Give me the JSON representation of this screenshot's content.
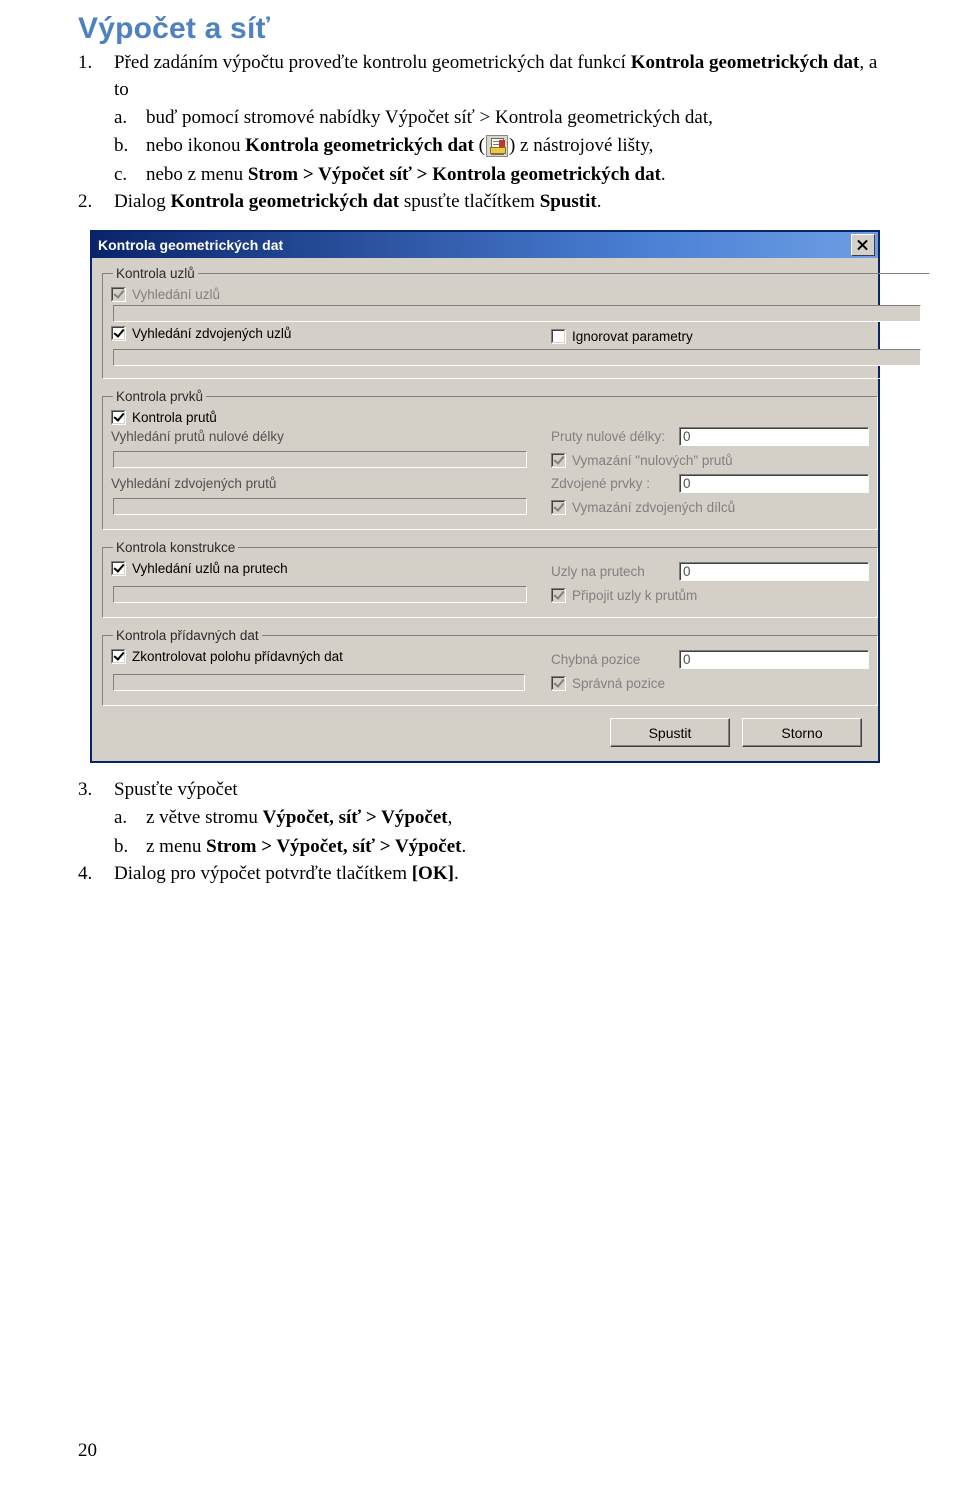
{
  "doc": {
    "title": "Výpočet a síť",
    "page_number": "20"
  },
  "steps": [
    {
      "num": "1.",
      "text_before": "Před zadáním výpočtu proveďte kontrolu geometrických dat funkcí ",
      "bold": "Kontrola geometrických dat",
      "text_after": ", a to",
      "subs": [
        {
          "letter": "a.",
          "pre": "buď pomocí stromové nabídky Výpočet síť > Kontrola geometrických dat,",
          "bold": "",
          "post": ""
        },
        {
          "letter": "b.",
          "pre": "nebo ikonou ",
          "bold": "Kontrola geometrických dat",
          "post": " (",
          "icon": "check-geometry-toolbar-icon",
          "post2": ") z nástrojové lišty,"
        },
        {
          "letter": "c.",
          "pre": "nebo z menu ",
          "bold": "Strom > Výpočet síť > Kontrola geometrických dat",
          "post": "."
        }
      ]
    },
    {
      "num": "2.",
      "text_before": "Dialog ",
      "bold": "Kontrola geometrických dat",
      "text_mid": " spusťte tlačítkem ",
      "bold2": "Spustit",
      "text_after": "."
    },
    {
      "num": "3.",
      "text_before": "Spusťte výpočet",
      "subs": [
        {
          "letter": "a.",
          "pre": "z  větve stromu  ",
          "bold": "Výpočet, síť  > Výpočet",
          "post": ","
        },
        {
          "letter": "b.",
          "pre": "z menu ",
          "bold": "Strom > Výpočet, síť > Výpočet",
          "post": "."
        }
      ]
    },
    {
      "num": "4.",
      "text_before": "Dialog pro výpočet potvrďte tlačítkem ",
      "bold": "[OK]",
      "text_after": "."
    }
  ],
  "dialog": {
    "title": "Kontrola geometrických dat",
    "close_button": "✕",
    "groups": [
      {
        "legend": "Kontrola uzlů",
        "rows": [
          {
            "checkbox": {
              "label": "Vyhledání uzlů",
              "checked": true,
              "disabled": true
            }
          },
          {
            "progress": true
          },
          {
            "checkbox": {
              "label": "Vyhledání zdvojených uzlů",
              "checked": true,
              "disabled": false
            },
            "checkbox_right": {
              "label": "Ignorovat parametry",
              "checked": false,
              "disabled": false
            }
          },
          {
            "progress": true
          }
        ]
      },
      {
        "legend": "Kontrola prvků",
        "rows": [
          {
            "checkbox": {
              "label": "Kontrola prutů",
              "checked": true,
              "disabled": false
            }
          },
          {
            "label": "Vyhledání prutů nulové délky",
            "field_label": "Pruty nulové délky:",
            "field_value": "0"
          },
          {
            "progress": true,
            "checkbox_right": {
              "label": "Vymazání \"nulových\" prutů",
              "checked": true,
              "disabled": true
            }
          },
          {
            "label": "Vyhledání zdvojených prutů",
            "field_label": "Zdvojené prvky :",
            "field_value": "0"
          },
          {
            "progress": true,
            "checkbox_right": {
              "label": "Vymazání zdvojených dílců",
              "checked": true,
              "disabled": true
            }
          }
        ]
      },
      {
        "legend": "Kontrola konstrukce",
        "rows": [
          {
            "checkbox": {
              "label": "Vyhledání uzlů na prutech",
              "checked": true,
              "disabled": false
            },
            "field_label": "Uzly na prutech",
            "field_value": "0"
          },
          {
            "progress": true,
            "checkbox_right": {
              "label": "Připojit uzly k prutům",
              "checked": true,
              "disabled": true
            }
          }
        ]
      },
      {
        "legend": "Kontrola přídavných dat",
        "rows": [
          {
            "checkbox": {
              "label": "Zkontrolovat polohu přídavných dat",
              "checked": true,
              "disabled": false
            },
            "field_label": "Chybná pozice",
            "field_value": "0"
          },
          {
            "progress": true,
            "checkbox_right": {
              "label": "Správná pozice",
              "checked": true,
              "disabled": true
            }
          }
        ]
      }
    ],
    "buttons": {
      "run": "Spustit",
      "cancel": "Storno"
    }
  }
}
